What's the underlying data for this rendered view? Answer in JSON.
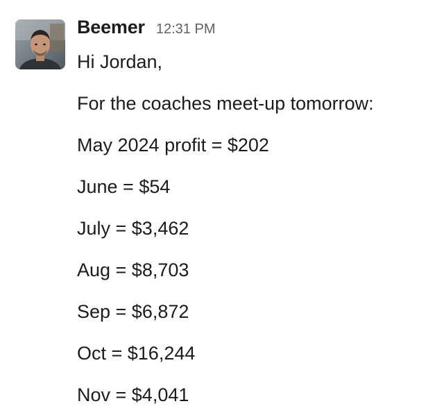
{
  "message": {
    "author": "Beemer",
    "timestamp": "12:31 PM",
    "avatar_icon": "user-photo-avatar",
    "lines": [
      "Hi Jordan,",
      "For the coaches meet-up tomorrow:",
      "May 2024 profit = $202",
      "June = $54",
      "July = $3,462",
      "Aug = $8,703",
      "Sep = $6,872",
      "Oct = $16,244",
      "Nov = $4,041"
    ]
  },
  "colors": {
    "text": "#1d1c1d",
    "timestamp": "#616061",
    "background": "#ffffff"
  }
}
